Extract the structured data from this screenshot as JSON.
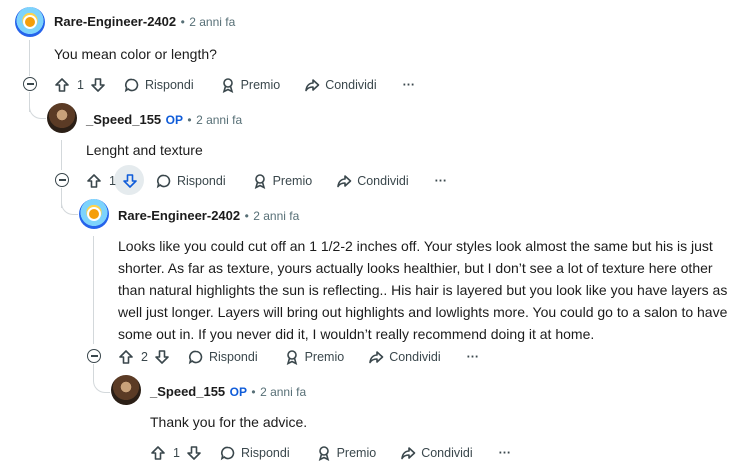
{
  "comments": [
    {
      "username": "Rare-Engineer-2402",
      "op": "",
      "time": "2 anni fa",
      "text": "You mean color or length?",
      "votes": "1"
    },
    {
      "username": "_Speed_155",
      "op": "OP",
      "time": "2 anni fa",
      "text": "Lenght and texture",
      "votes": "1"
    },
    {
      "username": "Rare-Engineer-2402",
      "op": "",
      "time": "2 anni fa",
      "text": "Looks like you could cut off an 1 1/2-2 inches off. Your styles look almost the same but his is just shorter. As far as texture, yours actually looks healthier, but I don’t see a lot of texture here other than natural highlights the sun is reflecting.. His hair is layered but you look like you have layers as well just longer. Layers will bring out highlights and lowlights more. You could go to a salon to have some out in. If you never did it, I wouldn’t really recommend doing it at home.",
      "votes": "2"
    },
    {
      "username": "_Speed_155",
      "op": "OP",
      "time": "2 anni fa",
      "text": "Thank you for the advice.",
      "votes": "1"
    }
  ],
  "actions": {
    "reply": "Rispondi",
    "award": "Premio",
    "share": "Condividi",
    "more": "···",
    "dot": "•"
  },
  "colors": {
    "op_blue": "#0f5cd9",
    "meta": "#576f76",
    "thread_line": "#d3d8db"
  }
}
